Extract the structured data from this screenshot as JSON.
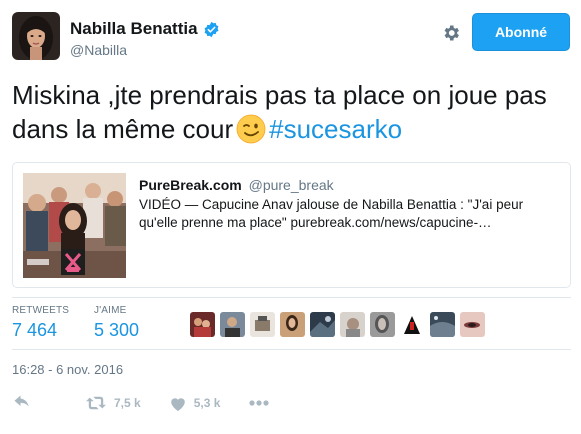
{
  "author": {
    "display_name": "Nabilla Benattia",
    "handle": "@Nabilla",
    "verified_icon": "verified-badge-icon"
  },
  "header": {
    "follow_label": "Abonné",
    "settings_icon": "gear-icon"
  },
  "tweet": {
    "text": "Miskina ,jte prendrais pas ta place on joue pas dans la même cour",
    "emoji": "winking-face-emoji",
    "hashtag": "#sucesarko"
  },
  "card": {
    "source_name": "PureBreak.com",
    "source_handle": "@pure_break",
    "description": "VIDÉO — Capucine Anav jalouse de Nabilla Benattia : \"J'ai peur qu'elle prenne ma place\" purebreak.com/news/capucine-…"
  },
  "stats": {
    "retweets_label": "RETWEETS",
    "retweets_value": "7 464",
    "likes_label": "J'AIME",
    "likes_value": "5 300"
  },
  "timestamp": "16:28 - 6 nov. 2016",
  "actions": {
    "reply_icon": "reply-icon",
    "retweet_icon": "retweet-icon",
    "retweet_count": "7,5 k",
    "like_icon": "heart-icon",
    "like_count": "5,3 k",
    "more_icon": "more-dots-icon"
  },
  "colors": {
    "accent": "#1da1f2",
    "link": "#1b95e0",
    "muted": "#657786",
    "action": "#aab8c2"
  }
}
